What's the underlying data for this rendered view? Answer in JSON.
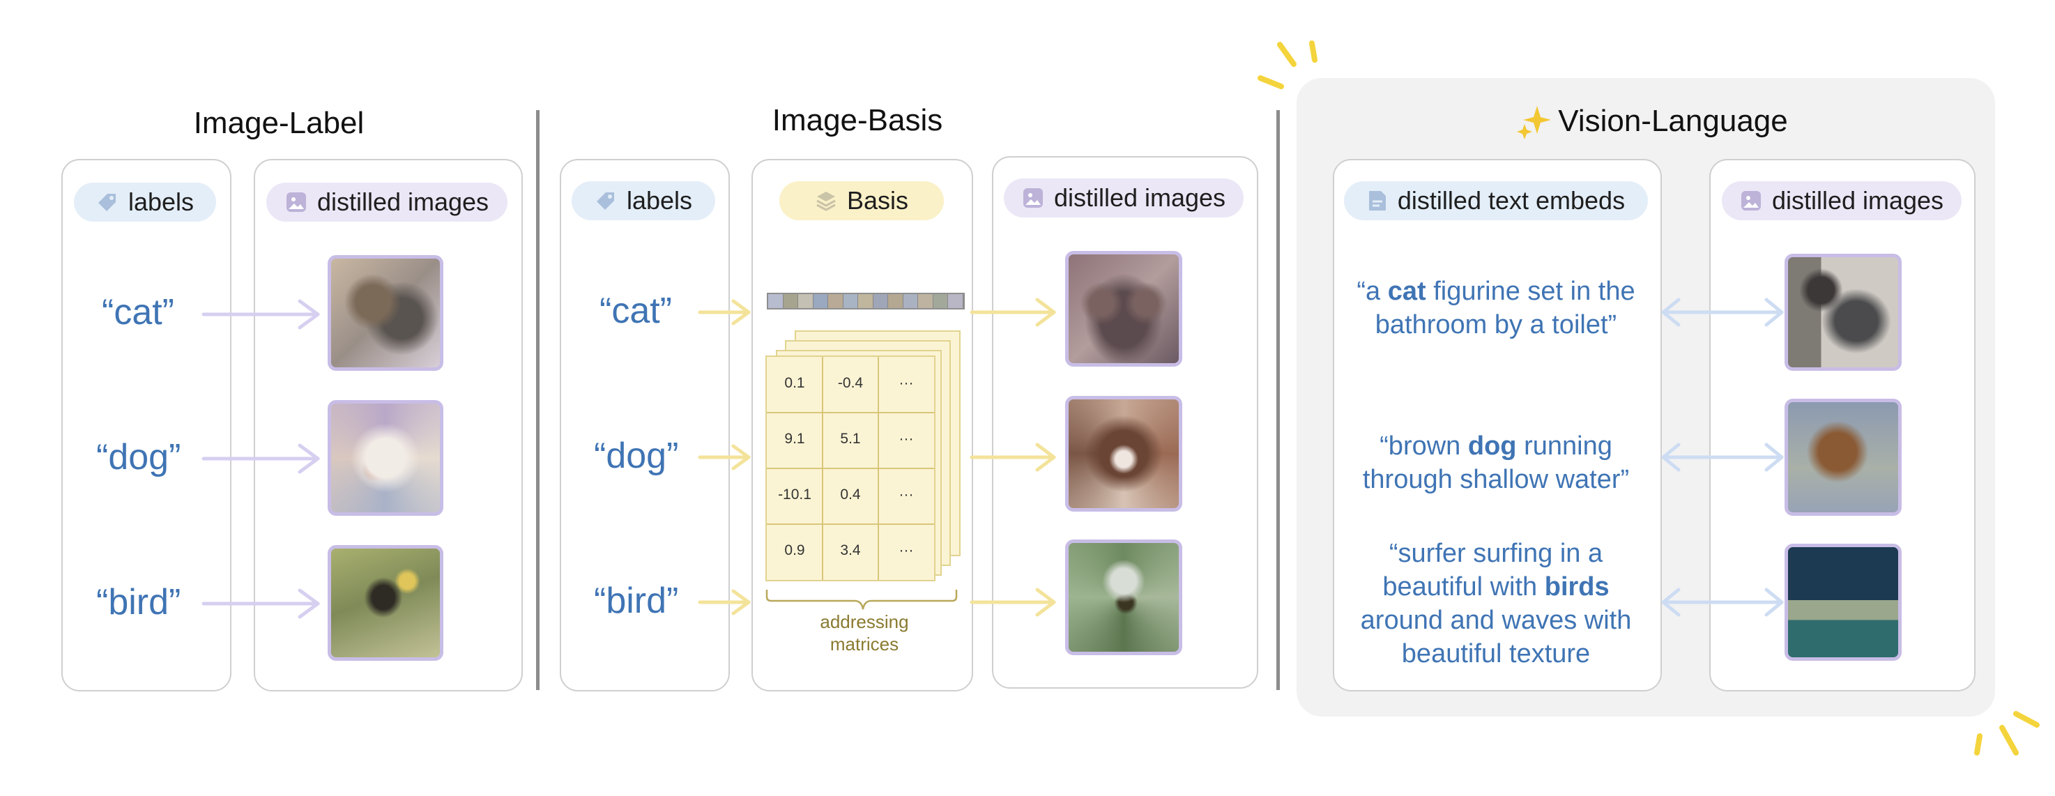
{
  "sections": {
    "image_label": {
      "title": "Image-Label",
      "labels_pill": "labels",
      "images_pill": "distilled images",
      "words": [
        "“cat”",
        "“dog”",
        "“bird”"
      ]
    },
    "image_basis": {
      "title": "Image-Basis",
      "labels_pill": "labels",
      "basis_pill": "Basis",
      "images_pill": "distilled images",
      "words": [
        "“cat”",
        "“dog”",
        "“bird”"
      ],
      "matrix": [
        [
          "0.1",
          "-0.4",
          "···"
        ],
        [
          "9.1",
          "5.1",
          "···"
        ],
        [
          "-10.1",
          "0.4",
          "···"
        ],
        [
          "0.9",
          "3.4",
          "···"
        ]
      ],
      "matrix_caption_1": "addressing",
      "matrix_caption_2": "matrices"
    },
    "vision_language": {
      "title": "Vision-Language",
      "text_pill": "distilled text embeds",
      "images_pill": "distilled images",
      "captions": [
        {
          "pre": "“a ",
          "bold": "cat",
          "post": " figurine set in the bathroom by a toilet”"
        },
        {
          "pre": "“brown ",
          "bold": "dog",
          "post": " running through shallow water”"
        },
        {
          "pre": "“surfer surfing in a beautiful with ",
          "bold": "birds",
          "post": " around and waves with beautiful texture"
        }
      ]
    }
  },
  "colors": {
    "label_text": "#3f74b4",
    "purple_arrow": "#d6cff0",
    "yellow_arrow": "#f3e39a",
    "blue_arrow": "#cddcf2",
    "thumb_border": "#c8bde6",
    "sparkle": "#f4d43c"
  },
  "icons": {
    "tag": "tag-icon",
    "image": "image-icon",
    "layers": "layers-icon",
    "document": "document-icon",
    "sparkles": "sparkles-icon"
  }
}
